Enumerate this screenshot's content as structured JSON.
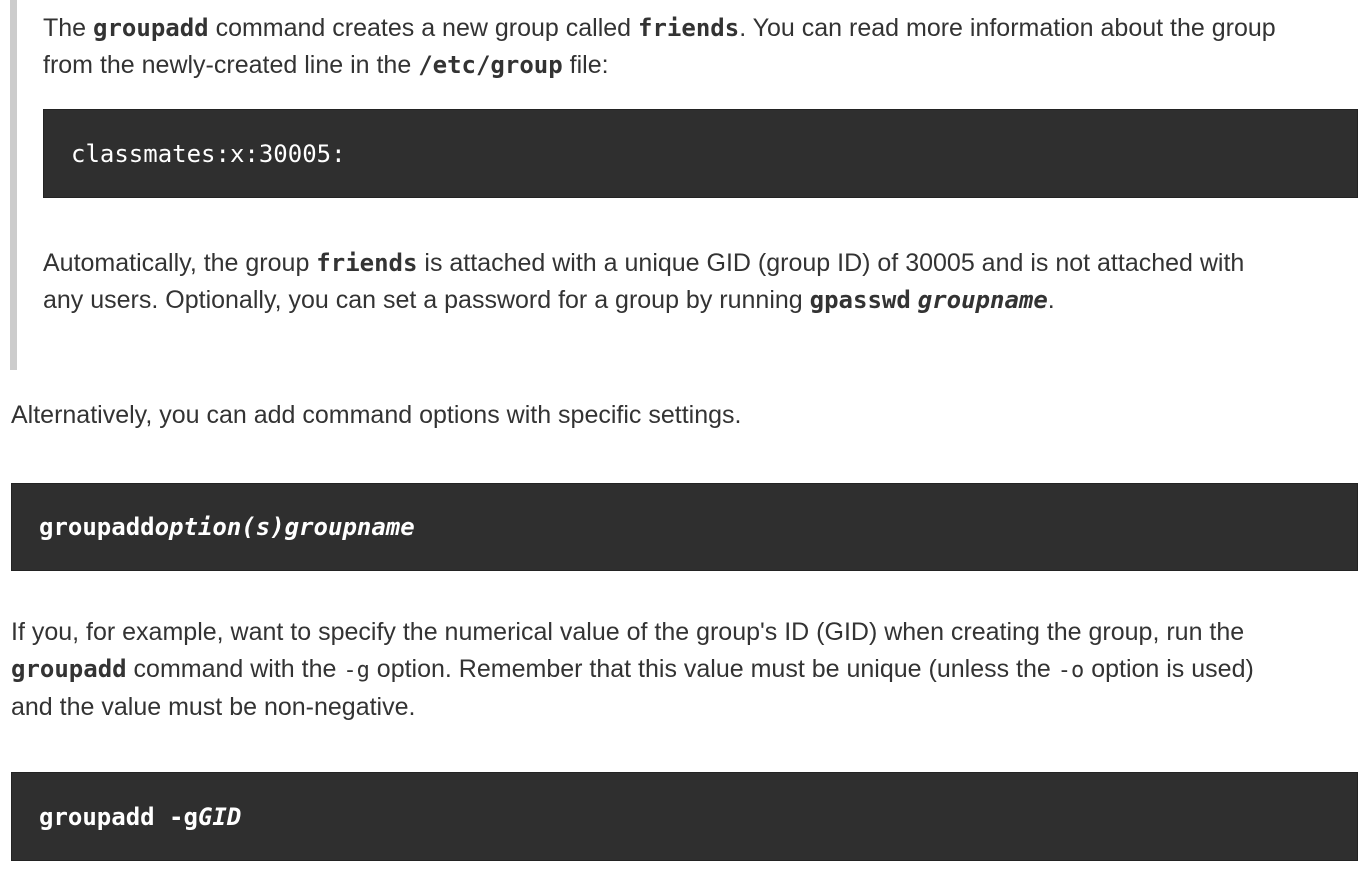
{
  "blockquote": {
    "p1": {
      "t1": "The ",
      "c1": "groupadd",
      "t2": " command creates a new group called ",
      "c2": "friends",
      "t3": ". You can read more information about the group",
      "t4": "from the newly-created line in the ",
      "c3": "/etc/group",
      "t5": " file:"
    },
    "code1": "classmates:x:30005:",
    "p2": {
      "t1": "Automatically, the group ",
      "c1": "friends",
      "t2": " is attached with a unique GID (group ID) of 30005 and is not attached with",
      "t3": "any users. Optionally, you can set a password for a group by running ",
      "c2": "gpasswd",
      "c3": "groupname",
      "t4": "."
    }
  },
  "p3": "Alternatively, you can add command options with specific settings.",
  "code2": {
    "cmd": "groupadd",
    "arg1": "option(s)",
    "arg2": "groupname"
  },
  "p4": {
    "t1": "If you, for example, want to specify the numerical value of the group's ID (GID) when creating the group, run the",
    "c1": "groupadd",
    "t2": " command with the ",
    "c2": "-g",
    "t3": " option. Remember that this value must be unique (unless the ",
    "c3": "-o",
    "t4": " option is used)",
    "t5": "and the value must be non-negative."
  },
  "code3": {
    "cmd": "groupadd -g",
    "arg": "GID"
  }
}
